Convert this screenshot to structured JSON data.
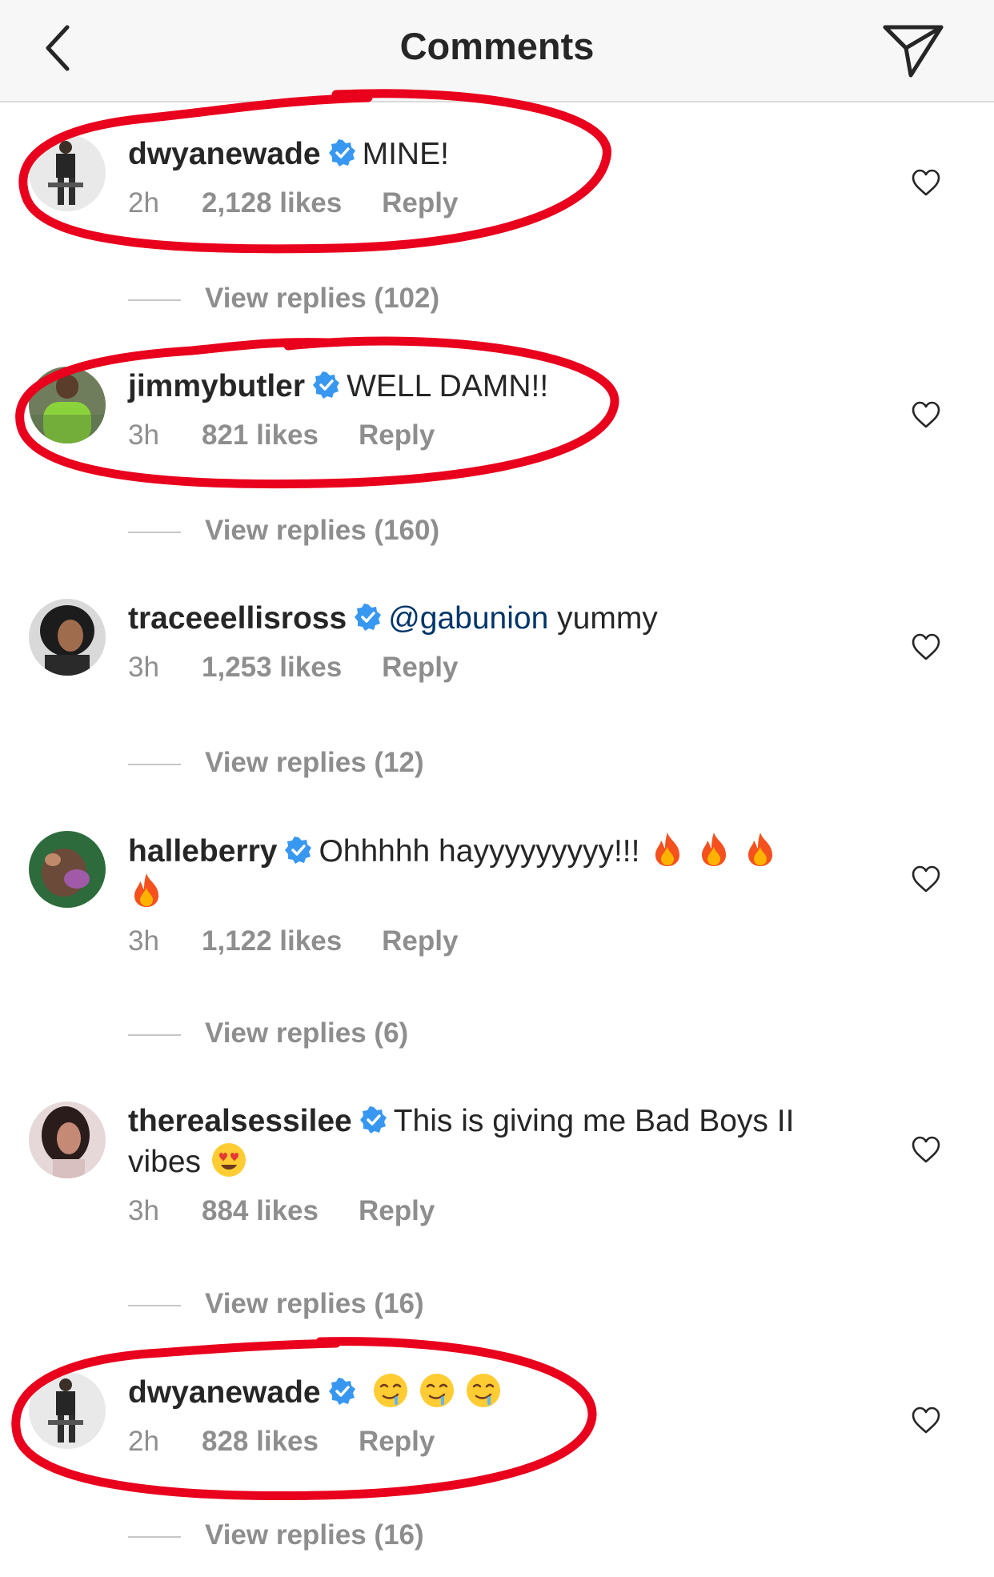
{
  "header": {
    "title": "Comments",
    "back_icon": "chevron-left-icon",
    "send_icon": "paper-plane-icon"
  },
  "comments": [
    {
      "username": "dwyanewade",
      "text": "MINE!",
      "time": "2h",
      "likes": "2,128 likes",
      "reply": "Reply",
      "view_replies": "View replies (102)",
      "highlighted": true
    },
    {
      "username": "jimmybutler",
      "text": "WELL DAMN!!",
      "time": "3h",
      "likes": "821 likes",
      "reply": "Reply",
      "view_replies": "View replies (160)",
      "highlighted": true
    },
    {
      "username": "traceeellisross",
      "mention": "@gabunion",
      "text": "yummy",
      "time": "3h",
      "likes": "1,253 likes",
      "reply": "Reply",
      "view_replies": "View replies (12)",
      "highlighted": false
    },
    {
      "username": "halleberry",
      "text": "Ohhhhh hayyyyyyyyy!!!",
      "emoji": "fire-emoji",
      "emoji_count": 4,
      "time": "3h",
      "likes": "1,122 likes",
      "reply": "Reply",
      "view_replies": "View replies (6)",
      "highlighted": false
    },
    {
      "username": "therealsessilee",
      "text": "This is giving me Bad Boys II",
      "text_line2": "vibes",
      "emoji": "heart-eyes-emoji",
      "emoji_count": 1,
      "time": "3h",
      "likes": "884 likes",
      "reply": "Reply",
      "view_replies": "View replies (16)",
      "highlighted": false
    },
    {
      "username": "dwyanewade",
      "text": "",
      "emoji": "drooling-face-emoji",
      "emoji_count": 3,
      "time": "2h",
      "likes": "828 likes",
      "reply": "Reply",
      "view_replies": "View replies (16)",
      "highlighted": true
    }
  ],
  "colors": {
    "text": "#262626",
    "meta": "#8e8e8e",
    "verified": "#3897f0",
    "mention": "#003569",
    "highlight_circle": "#e8001c",
    "header_bg": "#f7f7f7"
  }
}
